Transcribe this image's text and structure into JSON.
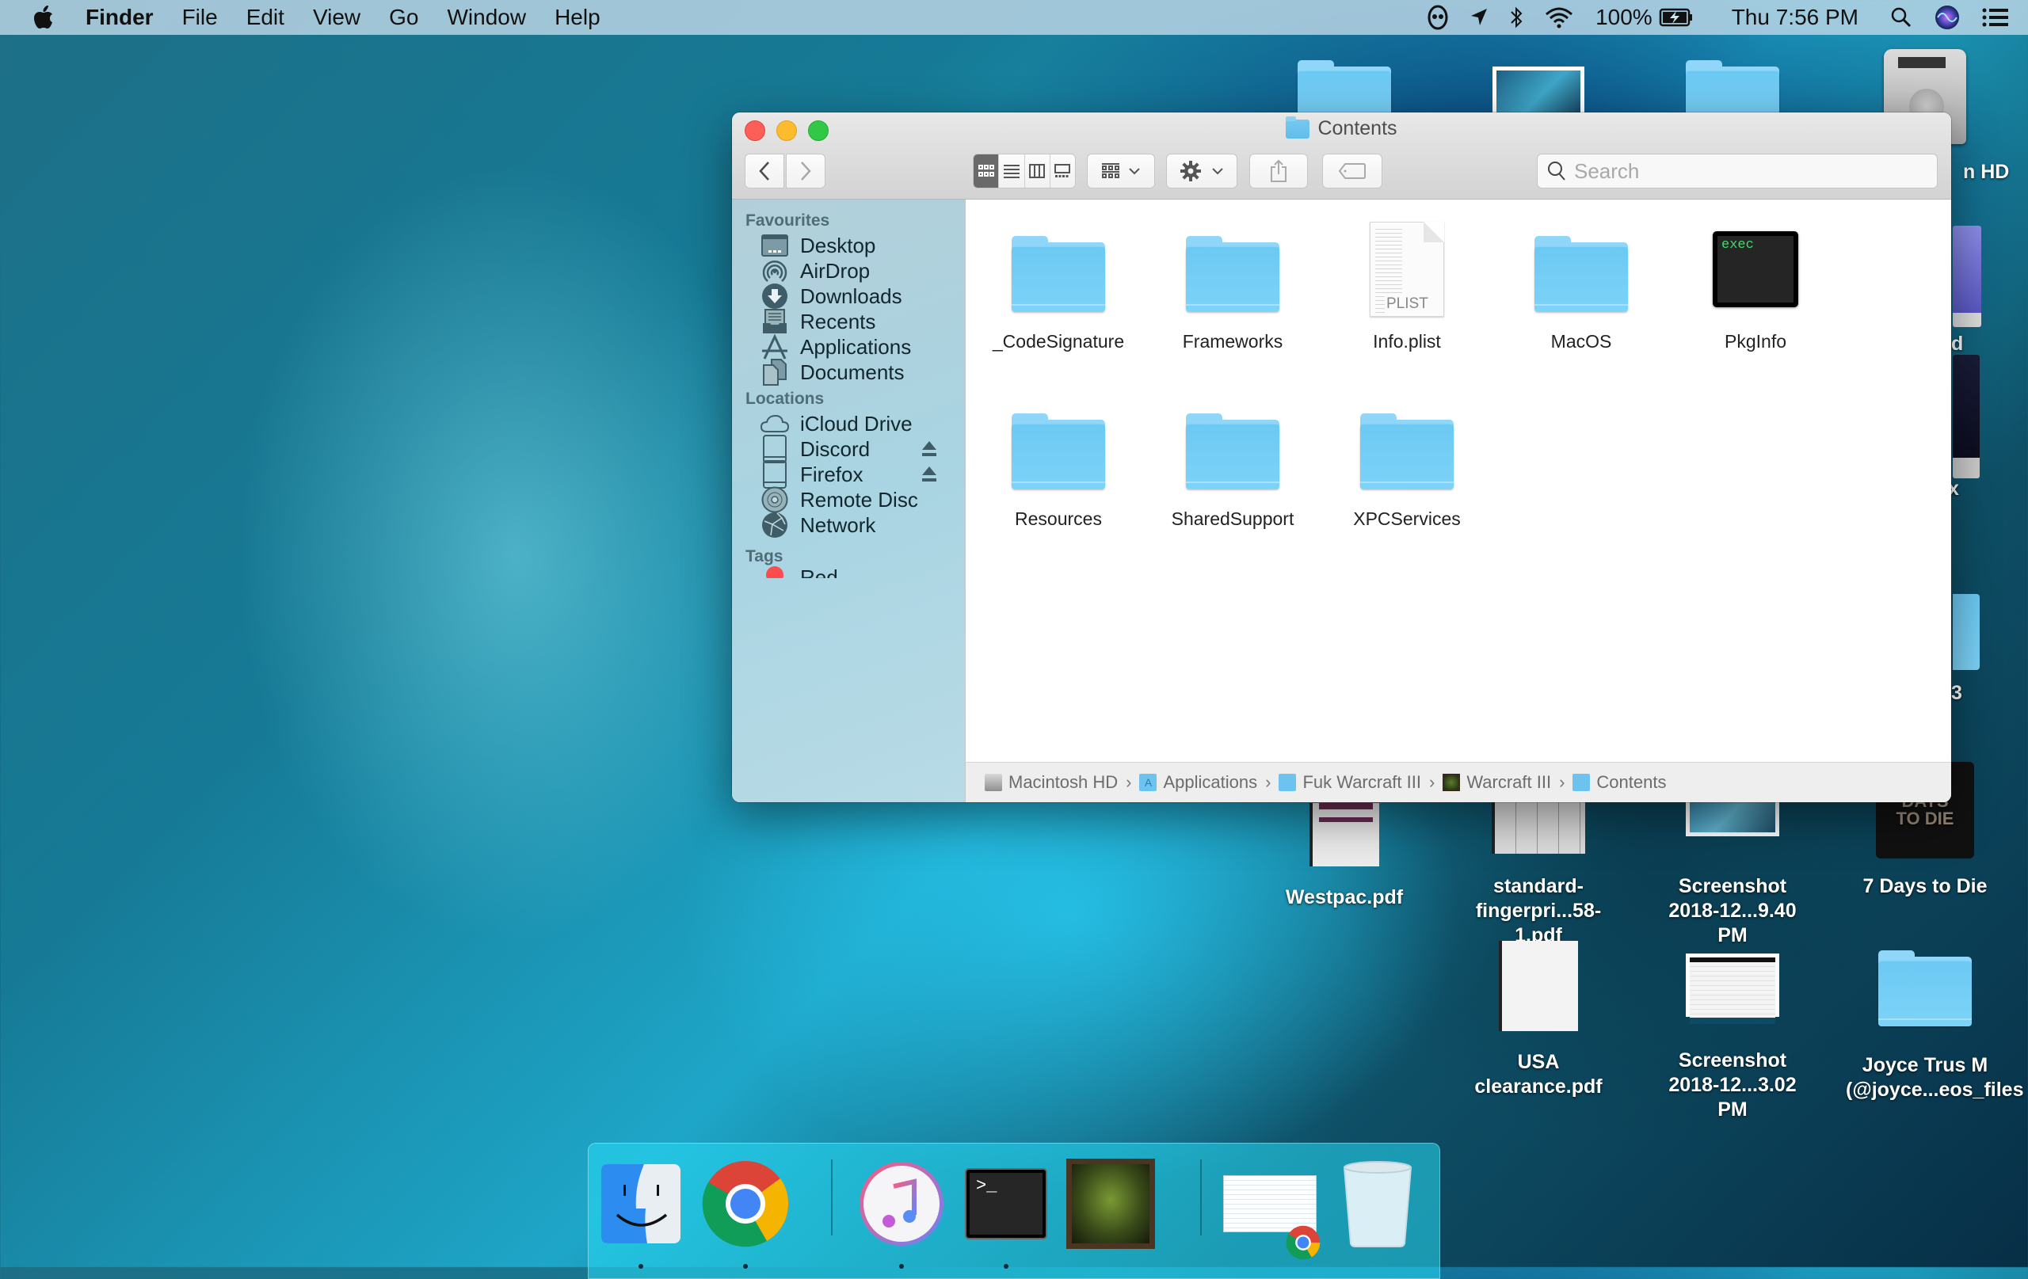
{
  "menubar": {
    "app_name": "Finder",
    "menus": [
      "File",
      "Edit",
      "View",
      "Go",
      "Window",
      "Help"
    ],
    "status": {
      "battery": "100%",
      "clock": "Thu 7:56 PM"
    }
  },
  "window": {
    "title": "Contents",
    "search": {
      "placeholder": "Search",
      "value": ""
    },
    "view_mode": "icon",
    "sidebar": {
      "favourites_heading": "Favourites",
      "favourites": [
        {
          "label": "Desktop",
          "icon": "desktop-icon"
        },
        {
          "label": "AirDrop",
          "icon": "airdrop-icon"
        },
        {
          "label": "Downloads",
          "icon": "downloads-icon"
        },
        {
          "label": "Recents",
          "icon": "recents-icon"
        },
        {
          "label": "Applications",
          "icon": "applications-icon"
        },
        {
          "label": "Documents",
          "icon": "documents-icon"
        }
      ],
      "locations_heading": "Locations",
      "locations": [
        {
          "label": "iCloud Drive",
          "icon": "cloud-icon",
          "eject": false
        },
        {
          "label": "Discord",
          "icon": "disk-icon",
          "eject": true
        },
        {
          "label": "Firefox",
          "icon": "disk-icon",
          "eject": true
        },
        {
          "label": "Remote Disc",
          "icon": "disc-icon",
          "eject": false
        },
        {
          "label": "Network",
          "icon": "network-icon",
          "eject": false
        }
      ],
      "tags_heading": "Tags",
      "tags": [
        {
          "label": "Red",
          "color": "#fc4c4e"
        }
      ]
    },
    "files": [
      {
        "name": "_CodeSignature",
        "type": "folder"
      },
      {
        "name": "Frameworks",
        "type": "folder"
      },
      {
        "name": "Info.plist",
        "type": "plist",
        "badge": "PLIST"
      },
      {
        "name": "MacOS",
        "type": "folder"
      },
      {
        "name": "PkgInfo",
        "type": "exec",
        "badge": "exec"
      },
      {
        "name": "Resources",
        "type": "folder"
      },
      {
        "name": "SharedSupport",
        "type": "folder"
      },
      {
        "name": "XPCServices",
        "type": "folder"
      }
    ],
    "path": [
      {
        "label": "Macintosh HD",
        "icon": "hard-drive-icon"
      },
      {
        "label": "Applications",
        "icon": "applications-folder-icon"
      },
      {
        "label": "Fuk Warcraft III",
        "icon": "folder-icon"
      },
      {
        "label": "Warcraft III",
        "icon": "warcraft-app-icon"
      },
      {
        "label": "Contents",
        "icon": "folder-icon"
      }
    ]
  },
  "desktop": {
    "items": [
      {
        "name": "",
        "type": "folder"
      },
      {
        "name": "",
        "type": "screenshot"
      },
      {
        "name": "",
        "type": "folder"
      },
      {
        "name": "n HD",
        "type": "hard-drive"
      },
      {
        "name": "d",
        "type": "usb-drive"
      },
      {
        "name": "x",
        "type": "usb-drive"
      },
      {
        "name": "3",
        "type": "folder"
      },
      {
        "name": "Westpac.pdf",
        "type": "pdf"
      },
      {
        "name": "standard-\nfingerpri...58-1.pdf",
        "type": "pdf"
      },
      {
        "name": "Screenshot\n2018-12...9.40 PM",
        "type": "screenshot"
      },
      {
        "name": "7 Days to Die",
        "type": "app"
      },
      {
        "name": "USA clearance.pdf",
        "type": "pdf"
      },
      {
        "name": "Screenshot\n2018-12...3.02 PM",
        "type": "screenshot"
      },
      {
        "name": "Joyce Trus M\n(@joyce...eos_files",
        "type": "folder"
      }
    ]
  },
  "dock": {
    "items": [
      {
        "name": "Finder",
        "running": true
      },
      {
        "name": "Google Chrome",
        "running": true
      },
      {
        "name": "iTunes",
        "running": true
      },
      {
        "name": "Terminal",
        "running": true
      },
      {
        "name": "Warcraft III",
        "running": false
      },
      {
        "name": "Chrome document",
        "running": false
      },
      {
        "name": "Trash",
        "running": false
      }
    ],
    "terminal_prompt": ">_"
  }
}
